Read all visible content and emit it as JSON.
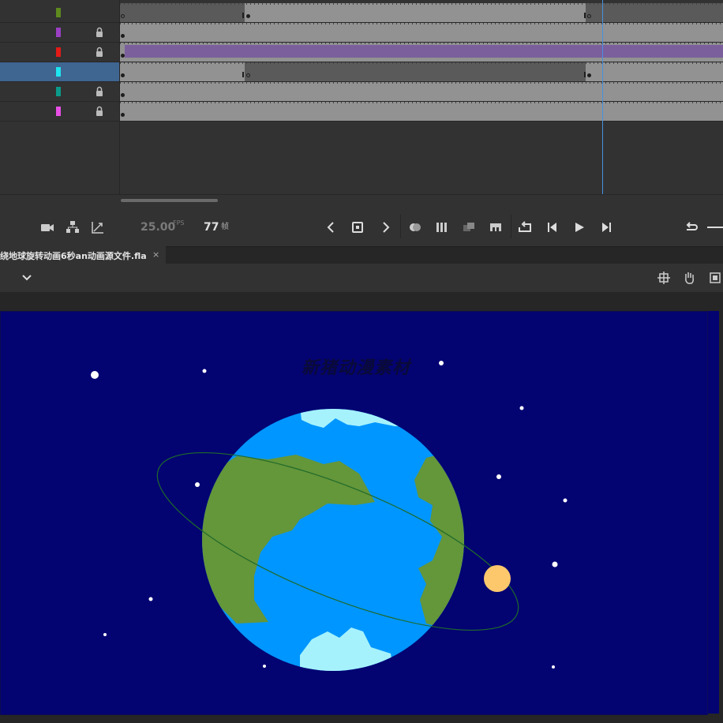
{
  "layers": [
    {
      "color": "#5e8a1e",
      "locked": false,
      "selected": false
    },
    {
      "color": "#9b3fc4",
      "locked": true,
      "selected": false
    },
    {
      "color": "#e41b17",
      "locked": true,
      "selected": false
    },
    {
      "color": "#1ee6f0",
      "locked": false,
      "selected": true
    },
    {
      "color": "#0a9a8a",
      "locked": true,
      "selected": false
    },
    {
      "color": "#e84fe6",
      "locked": true,
      "selected": false
    }
  ],
  "timeline": {
    "fps_value": "25.00",
    "fps_unit": "FPS",
    "current_frame": "77",
    "frame_unit": "帧"
  },
  "document": {
    "tab_label": "绕地球旋转动画6秒an动画源文件.fla",
    "close_glyph": "×"
  },
  "stage": {
    "title_text": "新猪动漫素材",
    "background": "#030372",
    "earth_ocean": "#0096ff",
    "earth_land": "#64963a",
    "earth_ice": "#a6f2fc",
    "moon_color": "#fdc86c",
    "orbit_color": "#1f6a2a"
  },
  "icons": {
    "camera": "camera-icon",
    "layer_parenting": "layer-parenting-icon",
    "graph": "graph-icon",
    "prev_keyframe": "chevron-left-icon",
    "insert_keyframe": "insert-keyframe-icon",
    "next_keyframe": "chevron-right-icon",
    "onion_skin": "onion-skin-icon",
    "edit_multiple": "edit-multiple-frames-icon",
    "center_frame": "center-frame-icon",
    "insert_classic": "insert-tween-icon",
    "loop": "loop-icon",
    "step_back": "step-back-icon",
    "play": "play-icon",
    "step_forward": "step-forward-icon",
    "undo": "undo-icon",
    "snap": "snap-icon",
    "hand": "hand-icon",
    "clip": "clip-icon",
    "dropdown": "chevron-down-icon"
  }
}
